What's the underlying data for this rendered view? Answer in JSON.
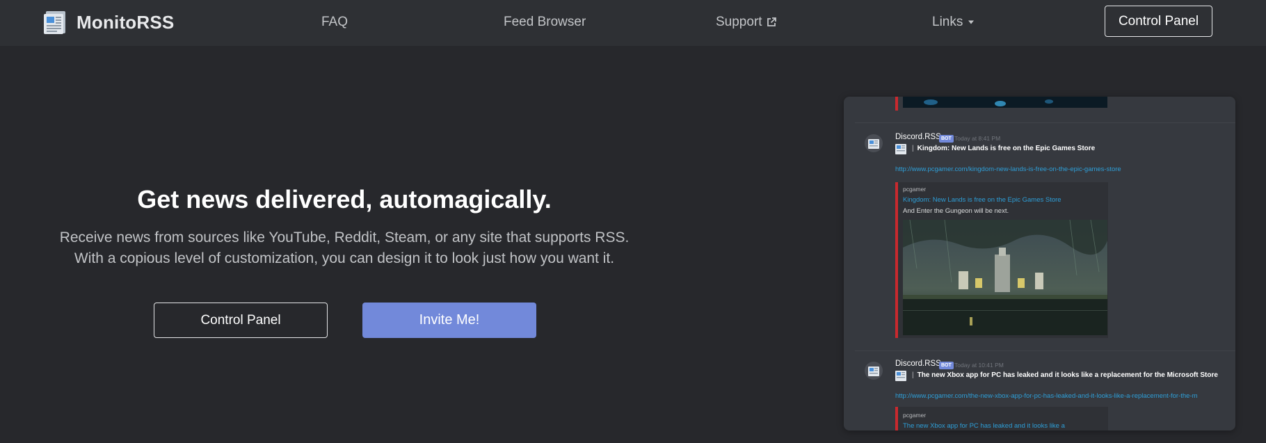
{
  "navbar": {
    "brand": "MonitoRSS",
    "links": {
      "faq": "FAQ",
      "feed_browser": "Feed Browser",
      "support": "Support",
      "links": "Links"
    },
    "control_panel": "Control Panel"
  },
  "hero": {
    "title": "Get news delivered, automagically.",
    "description_line1": "Receive news from sources like YouTube, Reddit, Steam, or any site that supports RSS.",
    "description_line2": "With a copious level of customization, you can design it to look just how you want it.",
    "control_panel_button": "Control Panel",
    "invite_button": "Invite Me!"
  },
  "preview": {
    "messages": [
      {
        "author": "Discord.RSS",
        "bot_tag": "BOT",
        "timestamp": "Today at 8:41 PM",
        "title": "Kingdom: New Lands is free on the Epic Games Store",
        "separator": "|",
        "link": "http://www.pcgamer.com/kingdom-new-lands-is-free-on-the-epic-games-store",
        "embed": {
          "source": "pcgamer",
          "title": "Kingdom: New Lands is free on the Epic Games Store",
          "description": "And Enter the Gungeon will be next."
        }
      },
      {
        "author": "Discord.RSS",
        "bot_tag": "BOT",
        "timestamp": "Today at 10:41 PM",
        "title": "The new Xbox app for PC has leaked and it looks like a replacement for the Microsoft Store",
        "separator": "|",
        "link": "http://www.pcgamer.com/the-new-xbox-app-for-pc-has-leaked-and-it-looks-like-a-replacement-for-the-m",
        "embed": {
          "source": "pcgamer",
          "title": "The new Xbox app for PC has leaked and it looks like a"
        }
      }
    ]
  },
  "colors": {
    "background": "#27282c",
    "navbar": "#2e3034",
    "accent": "#7289da",
    "embed_bar": "#c9292e",
    "link": "#2e9fd8"
  }
}
